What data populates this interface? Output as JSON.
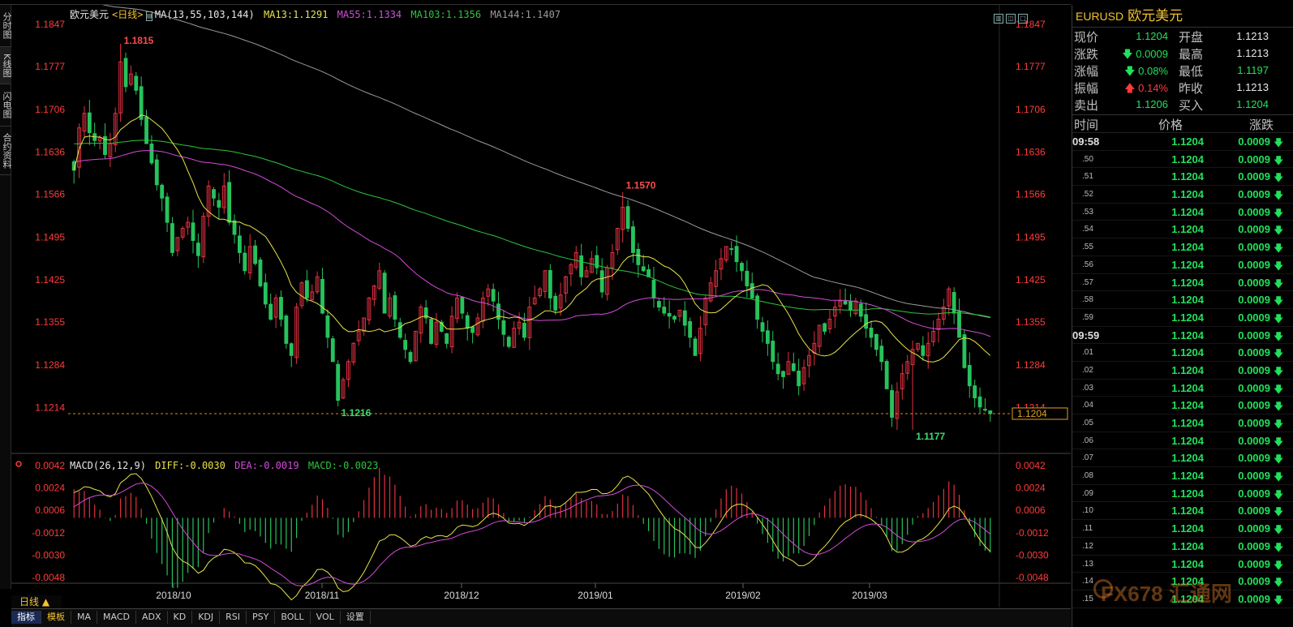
{
  "left_tabs": [
    "分时图",
    "K线图",
    "闪电图",
    "合约资料"
  ],
  "chart": {
    "symbol_title": "欧元美元",
    "period_label": "<日线>",
    "ma_header": "MA(13,55,103,144)",
    "ma13": "MA13:1.1291",
    "ma55": "MA55:1.1334",
    "ma103": "MA103:1.1356",
    "ma144": "MA144:1.1407",
    "macd_header": "MACD(26,12,9)",
    "diff": "DIFF:-0.0030",
    "dea": "DEA:-0.0019",
    "macd": "MACD:-0.0023",
    "current_price_tag": "1.1204",
    "high_label": "1.1815",
    "mid_high_label": "1.1570",
    "low_label_1": "1.1216",
    "low_label_2": "1.1177",
    "price_axis": [
      "1.1847",
      "1.1777",
      "1.1706",
      "1.1636",
      "1.1566",
      "1.1495",
      "1.1425",
      "1.1355",
      "1.1284",
      "1.1214"
    ],
    "macd_axis": [
      "0.0042",
      "0.0024",
      "0.0006",
      "-0.0012",
      "-0.0030",
      "-0.0048"
    ],
    "date_axis": [
      "2018/10",
      "2018/11",
      "2018/12",
      "2019/01",
      "2019/02",
      "2019/03"
    ],
    "colors": {
      "up": "#e2313f",
      "down": "#27c25c",
      "ma13": "#e8e34a",
      "ma55": "#d44bd9",
      "ma103": "#2ec43a",
      "ma144": "#9a9a9a",
      "axis_text": "#ff3b3b"
    }
  },
  "bottom_bar": {
    "period": "日线 ▲",
    "tabs": [
      "指标",
      "模板",
      "MA",
      "MACD",
      "ADX",
      "KD",
      "KDJ",
      "RSI",
      "PSY",
      "BOLL",
      "VOL",
      "设置"
    ]
  },
  "quote": {
    "code": "EURUSD",
    "name": "欧元美元",
    "rows": [
      {
        "l1": "现价",
        "v1": "1.1204",
        "c1": "g",
        "l2": "开盘",
        "v2": "1.1213",
        "c2": "w"
      },
      {
        "l1": "涨跌",
        "v1": "🡇 0.0009",
        "c1": "g",
        "l2": "最高",
        "v2": "1.1213",
        "c2": "w"
      },
      {
        "l1": "涨幅",
        "v1": "🡇 0.08%",
        "c1": "g",
        "l2": "最低",
        "v2": "1.1197",
        "c2": "g"
      },
      {
        "l1": "振幅",
        "v1": "🡅 0.14%",
        "c1": "r",
        "l2": "昨收",
        "v2": "1.1213",
        "c2": "w"
      },
      {
        "l1": "卖出",
        "v1": "1.1206",
        "c1": "g",
        "l2": "买入",
        "v2": "1.1204",
        "c2": "g"
      }
    ],
    "tick_headers": [
      "时间",
      "价格",
      "涨跌"
    ],
    "ticks": [
      {
        "t": "09:58",
        "kind": "big",
        "p": "1.1204",
        "c": "0.0009"
      },
      {
        "t": ".50",
        "kind": "small",
        "p": "1.1204",
        "c": "0.0009"
      },
      {
        "t": ".51",
        "kind": "small",
        "p": "1.1204",
        "c": "0.0009"
      },
      {
        "t": ".52",
        "kind": "small",
        "p": "1.1204",
        "c": "0.0009"
      },
      {
        "t": ".53",
        "kind": "small",
        "p": "1.1204",
        "c": "0.0009"
      },
      {
        "t": ".54",
        "kind": "small",
        "p": "1.1204",
        "c": "0.0009"
      },
      {
        "t": ".55",
        "kind": "small",
        "p": "1.1204",
        "c": "0.0009"
      },
      {
        "t": ".56",
        "kind": "small",
        "p": "1.1204",
        "c": "0.0009"
      },
      {
        "t": ".57",
        "kind": "small",
        "p": "1.1204",
        "c": "0.0009"
      },
      {
        "t": ".58",
        "kind": "small",
        "p": "1.1204",
        "c": "0.0009"
      },
      {
        "t": ".59",
        "kind": "small",
        "p": "1.1204",
        "c": "0.0009"
      },
      {
        "t": "09:59",
        "kind": "big",
        "p": "1.1204",
        "c": "0.0009"
      },
      {
        "t": ".01",
        "kind": "small",
        "p": "1.1204",
        "c": "0.0009"
      },
      {
        "t": ".02",
        "kind": "small",
        "p": "1.1204",
        "c": "0.0009"
      },
      {
        "t": ".03",
        "kind": "small",
        "p": "1.1204",
        "c": "0.0009"
      },
      {
        "t": ".04",
        "kind": "small",
        "p": "1.1204",
        "c": "0.0009"
      },
      {
        "t": ".05",
        "kind": "small",
        "p": "1.1204",
        "c": "0.0009"
      },
      {
        "t": ".06",
        "kind": "small",
        "p": "1.1204",
        "c": "0.0009"
      },
      {
        "t": ".07",
        "kind": "small",
        "p": "1.1204",
        "c": "0.0009"
      },
      {
        "t": ".08",
        "kind": "small",
        "p": "1.1204",
        "c": "0.0009"
      },
      {
        "t": ".09",
        "kind": "small",
        "p": "1.1204",
        "c": "0.0009"
      },
      {
        "t": ".10",
        "kind": "small",
        "p": "1.1204",
        "c": "0.0009"
      },
      {
        "t": ".11",
        "kind": "small",
        "p": "1.1204",
        "c": "0.0009"
      },
      {
        "t": ".12",
        "kind": "small",
        "p": "1.1204",
        "c": "0.0009"
      },
      {
        "t": ".13",
        "kind": "small",
        "p": "1.1204",
        "c": "0.0009"
      },
      {
        "t": ".14",
        "kind": "small",
        "p": "1.1204",
        "c": "0.0009"
      },
      {
        "t": ".15",
        "kind": "small",
        "p": "1.1204",
        "c": "0.0009"
      }
    ]
  },
  "watermark": "FX678 汇通网",
  "chart_data": {
    "type": "candlestick",
    "ma_periods": [
      13,
      55,
      103,
      144
    ],
    "price_range": [
      1.1177,
      1.1847
    ],
    "macd_range": [
      -0.0048,
      0.0042
    ],
    "closes": [
      1.1606,
      1.1676,
      1.17,
      1.1668,
      1.1655,
      1.166,
      1.1632,
      1.165,
      1.17,
      1.1785,
      1.1744,
      1.1765,
      1.1738,
      1.169,
      1.165,
      1.1618,
      1.1582,
      1.156,
      1.152,
      1.147,
      1.1495,
      1.151,
      1.152,
      1.149,
      1.1465,
      1.153,
      1.158,
      1.156,
      1.1545,
      1.158,
      1.152,
      1.15,
      1.147,
      1.144,
      1.148,
      1.1452,
      1.1415,
      1.1385,
      1.136,
      1.1395,
      1.136,
      1.132,
      1.13,
      1.138,
      1.142,
      1.1395,
      1.1405,
      1.143,
      1.137,
      1.133,
      1.129,
      1.1226,
      1.126,
      1.129,
      1.132,
      1.134,
      1.1362,
      1.1395,
      1.1415,
      1.144,
      1.137,
      1.1395,
      1.136,
      1.133,
      1.131,
      1.129,
      1.134,
      1.138,
      1.1362,
      1.132,
      1.1355,
      1.134,
      1.132,
      1.1365,
      1.1395,
      1.137,
      1.1345,
      1.1338,
      1.1362,
      1.1395,
      1.141,
      1.139,
      1.136,
      1.1335,
      1.1315,
      1.1345,
      1.1355,
      1.133,
      1.138,
      1.1395,
      1.141,
      1.144,
      1.1395,
      1.1375,
      1.14,
      1.143,
      1.145,
      1.147,
      1.143,
      1.144,
      1.146,
      1.1445,
      1.1405,
      1.1445,
      1.147,
      1.151,
      1.1545,
      1.151,
      1.147,
      1.145,
      1.144,
      1.143,
      1.1395,
      1.138,
      1.137,
      1.1365,
      1.136,
      1.1375,
      1.135,
      1.133,
      1.13,
      1.1345,
      1.1395,
      1.142,
      1.144,
      1.146,
      1.148,
      1.1475,
      1.1455,
      1.144,
      1.1415,
      1.1395,
      1.136,
      1.134,
      1.132,
      1.129,
      1.127,
      1.1265,
      1.129,
      1.1275,
      1.125,
      1.128,
      1.13,
      1.132,
      1.135,
      1.134,
      1.136,
      1.138,
      1.139,
      1.1385,
      1.1375,
      1.139,
      1.1365,
      1.1345,
      1.133,
      1.131,
      1.129,
      1.1245,
      1.1198,
      1.124,
      1.127,
      1.129,
      1.131,
      1.132,
      1.13,
      1.132,
      1.134,
      1.136,
      1.138,
      1.141,
      1.137,
      1.133,
      1.128,
      1.125,
      1.123,
      1.1215,
      1.121,
      1.1204
    ]
  }
}
